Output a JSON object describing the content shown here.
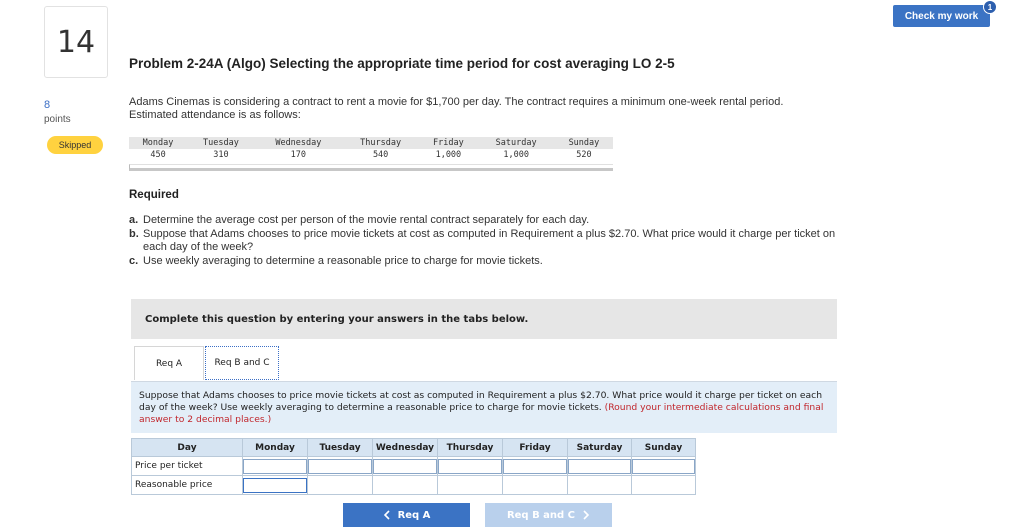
{
  "question": {
    "number": "14",
    "points_value": "8",
    "points_label": "points",
    "status": "Skipped"
  },
  "header": {
    "check_label": "Check my work",
    "check_badge": "1"
  },
  "problem": {
    "title": "Problem 2-24A (Algo) Selecting the appropriate time period for cost averaging LO 2-5",
    "intro_line1": "Adams Cinemas is considering a contract to rent a movie for $1,700 per day. The contract requires a minimum one-week rental period.",
    "intro_line2": "Estimated attendance is as follows:"
  },
  "attendance": {
    "days": [
      "Monday",
      "Tuesday",
      "Wednesday",
      "Thursday",
      "Friday",
      "Saturday",
      "Sunday"
    ],
    "values": [
      "450",
      "310",
      "170",
      "540",
      "1,000",
      "1,000",
      "520"
    ]
  },
  "required": {
    "heading": "Required",
    "items": [
      {
        "key": "a.",
        "text": "Determine the average cost per person of the movie rental contract separately for each day."
      },
      {
        "key": "b.",
        "text": "Suppose that Adams chooses to price movie tickets at cost as computed in Requirement a plus $2.70. What price would it charge per ticket on each day of the week?"
      },
      {
        "key": "c.",
        "text": "Use weekly averaging to determine a reasonable price to charge for movie tickets."
      }
    ]
  },
  "complete_prompt": "Complete this question by entering your answers in the tabs below.",
  "tabs": [
    "Req A",
    "Req B and C"
  ],
  "instructions": {
    "main": "Suppose that Adams chooses to price movie tickets at cost as computed in Requirement a plus $2.70. What price would it charge per ticket on each day of the week? Use weekly averaging to determine a reasonable price to charge for movie tickets.",
    "note": "(Round your intermediate calculations and final answer to 2 decimal places.)"
  },
  "answer_table": {
    "header_label": "Day",
    "columns": [
      "Monday",
      "Tuesday",
      "Wednesday",
      "Thursday",
      "Friday",
      "Saturday",
      "Sunday"
    ],
    "rows": [
      "Price per ticket",
      "Reasonable price"
    ]
  },
  "nav": {
    "prev_label": "Req A",
    "next_label": "Req B and C",
    "prev_icon": "chevron-left-icon",
    "next_icon": "chevron-right-icon"
  }
}
